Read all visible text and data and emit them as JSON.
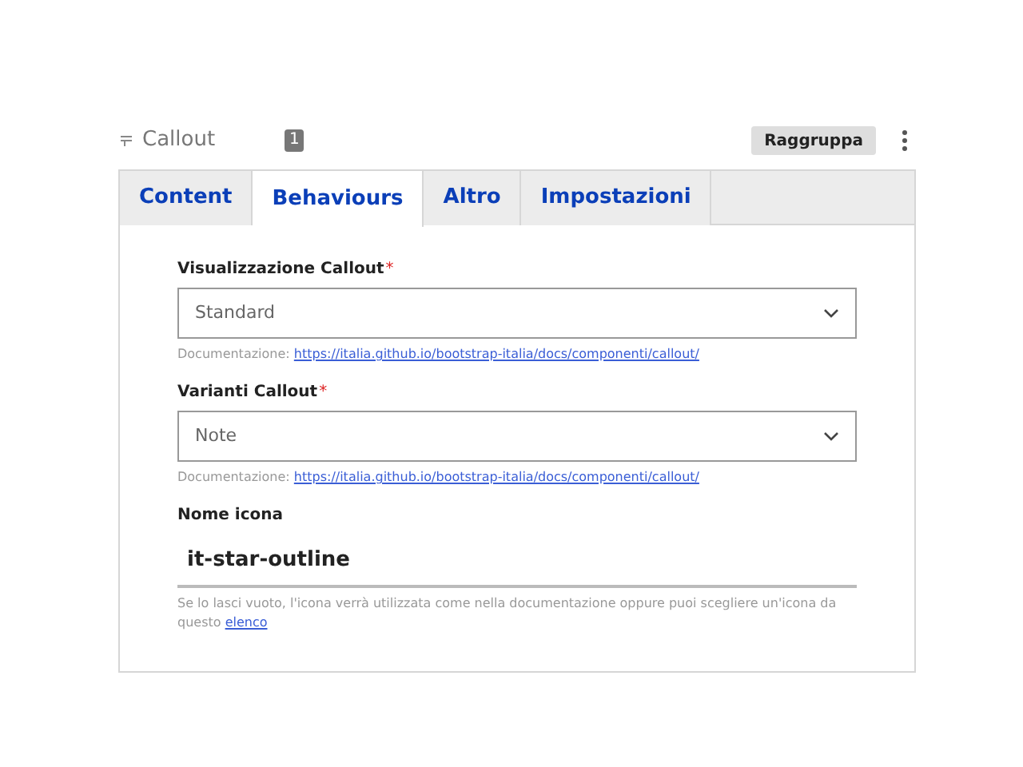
{
  "header": {
    "icon_title": "Callout",
    "count": "1",
    "group_button": "Raggruppa"
  },
  "tabs": [
    {
      "label": "Content",
      "selected": false
    },
    {
      "label": "Behaviours",
      "selected": true
    },
    {
      "label": "Altro",
      "selected": false
    },
    {
      "label": "Impostazioni",
      "selected": false
    }
  ],
  "fields": [
    {
      "kind": "select",
      "label": "Visualizzazione Callout",
      "required_mark": "*",
      "value": "Standard",
      "help": {
        "text": "Documentazione:",
        "link": "https://italia.github.io/bootstrap-italia/docs/componenti/callout/"
      }
    },
    {
      "kind": "select",
      "label": "Varianti Callout",
      "required_mark": "*",
      "value": "Note",
      "help": {
        "text": "Documentazione:",
        "link": "https://italia.github.io/bootstrap-italia/docs/componenti/callout/"
      }
    },
    {
      "kind": "text",
      "label": "Nome icona",
      "value": "it-star-outline",
      "help": {
        "text": "Se lo lasci vuoto, l'icona verrà utilizzata come nella documentazione oppure puoi scegliere un'icona da questo",
        "link": "elenco"
      }
    }
  ]
}
